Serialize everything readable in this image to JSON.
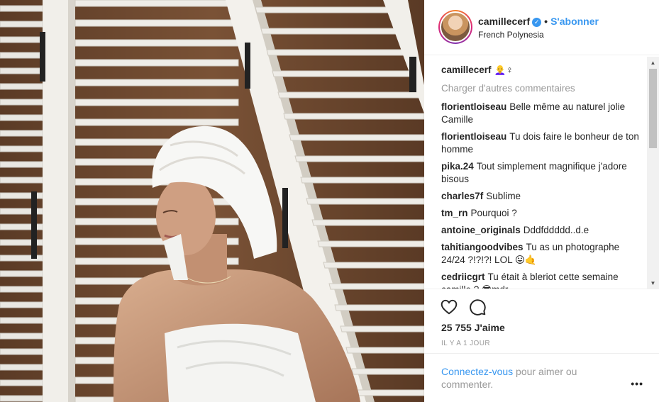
{
  "post": {
    "username": "camillecerf",
    "follow_label": "S'abonner",
    "location": "French Polynesia",
    "caption_emoji": "👩‍🦲♀"
  },
  "comments_section": {
    "load_more_label": "Charger d'autres commentaires",
    "items": [
      {
        "user": "florientloiseau",
        "text": "Belle même au naturel jolie Camille"
      },
      {
        "user": "florientloiseau",
        "text": "Tu dois faire le bonheur de ton homme"
      },
      {
        "user": "pika.24",
        "text": "Tout simplement magnifique j'adore bisous"
      },
      {
        "user": "charles7f",
        "text": "Sublime"
      },
      {
        "user": "tm_rn",
        "text": "Pourquoi ?"
      },
      {
        "user": "antoine_originals",
        "text": "Dddfddddd..d.e"
      },
      {
        "user": "tahitiangoodvibes",
        "text": "Tu as un photographe 24/24 ?!?!?! LOL 😛🤙"
      },
      {
        "user": "cedriicgrt",
        "text": "Tu était à bleriot cette semaine camille ? 😎mdr"
      }
    ]
  },
  "actions": {
    "like_icon": "heart-icon",
    "comment_icon": "comment-icon"
  },
  "stats": {
    "likes_label": "25 755 J'aime",
    "time_label": "IL Y A 1 JOUR"
  },
  "login_prompt": {
    "link_label": "Connectez-vous",
    "rest_label": " pour aimer ou commenter.",
    "more_label": "•••"
  },
  "colors": {
    "accent": "#3897f0",
    "muted": "#999999",
    "text": "#262626"
  }
}
